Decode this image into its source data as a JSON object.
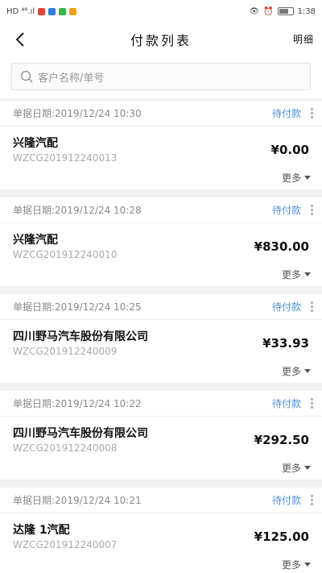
{
  "status_bar": {
    "left": "HD ⁴⁶.ıl",
    "time": "1:38"
  },
  "nav": {
    "title": "付款列表",
    "detail": "明细"
  },
  "search": {
    "placeholder": "客户名称/单号"
  },
  "orders": [
    {
      "date": "单据日期:2019/12/24 10:30",
      "status": "待付款",
      "company": "兴隆汽配",
      "order_no": "WZCG201912240013",
      "amount": "¥0.00",
      "more": "更多"
    },
    {
      "date": "单据日期:2019/12/24 10:28",
      "status": "待付款",
      "company": "兴隆汽配",
      "order_no": "WZCG201912240010",
      "amount": "¥830.00",
      "more": "更多"
    },
    {
      "date": "单据日期:2019/12/24 10:25",
      "status": "待付款",
      "company": "四川野马汽车股份有限公司",
      "order_no": "WZCG201912240009",
      "amount": "¥33.93",
      "more": "更多"
    },
    {
      "date": "单据日期:2019/12/24 10:22",
      "status": "待付款",
      "company": "四川野马汽车股份有限公司",
      "order_no": "WZCG201912240008",
      "amount": "¥292.50",
      "more": "更多"
    },
    {
      "date": "单据日期:2019/12/24 10:21",
      "status": "待付款",
      "company": "达隆 1汽配",
      "order_no": "WZCG201912240007",
      "amount": "¥125.00",
      "more": "更多"
    }
  ],
  "colors": {
    "status": "#4a90d9",
    "background": "#f2f2f2"
  }
}
